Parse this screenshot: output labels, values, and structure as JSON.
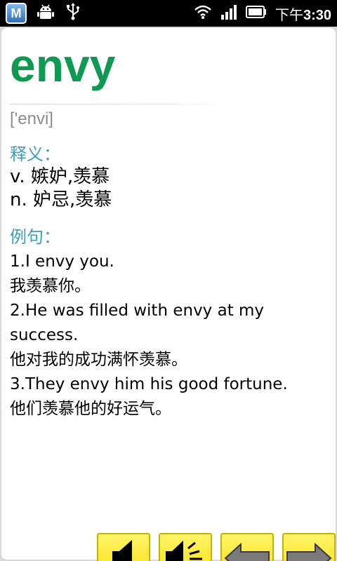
{
  "status_bar": {
    "app_badge": "M",
    "time_prefix": "下午",
    "time": "3:30"
  },
  "entry": {
    "word": "envy",
    "phonetic": "['envi]",
    "definition_label": "释义：",
    "definitions": [
      "v. 嫉妒,羡慕",
      "n. 妒忌,羡慕"
    ],
    "example_label": "例句：",
    "examples": [
      "1.I envy you.",
      "我羡慕你。",
      "2.He was filled with envy at my",
      "success.",
      "他对我的成功满怀羡慕。",
      "3.They envy him his good fortune.",
      "他们羡慕他的好运气。"
    ]
  },
  "colors": {
    "word": "#0f9a52",
    "section_label": "#3a9fb8",
    "phonetic": "#8c8c8c",
    "button": "#f5d800"
  },
  "buttons": [
    "speaker-icon",
    "speaker-loud-icon",
    "arrow-left-icon",
    "arrow-right-icon"
  ]
}
